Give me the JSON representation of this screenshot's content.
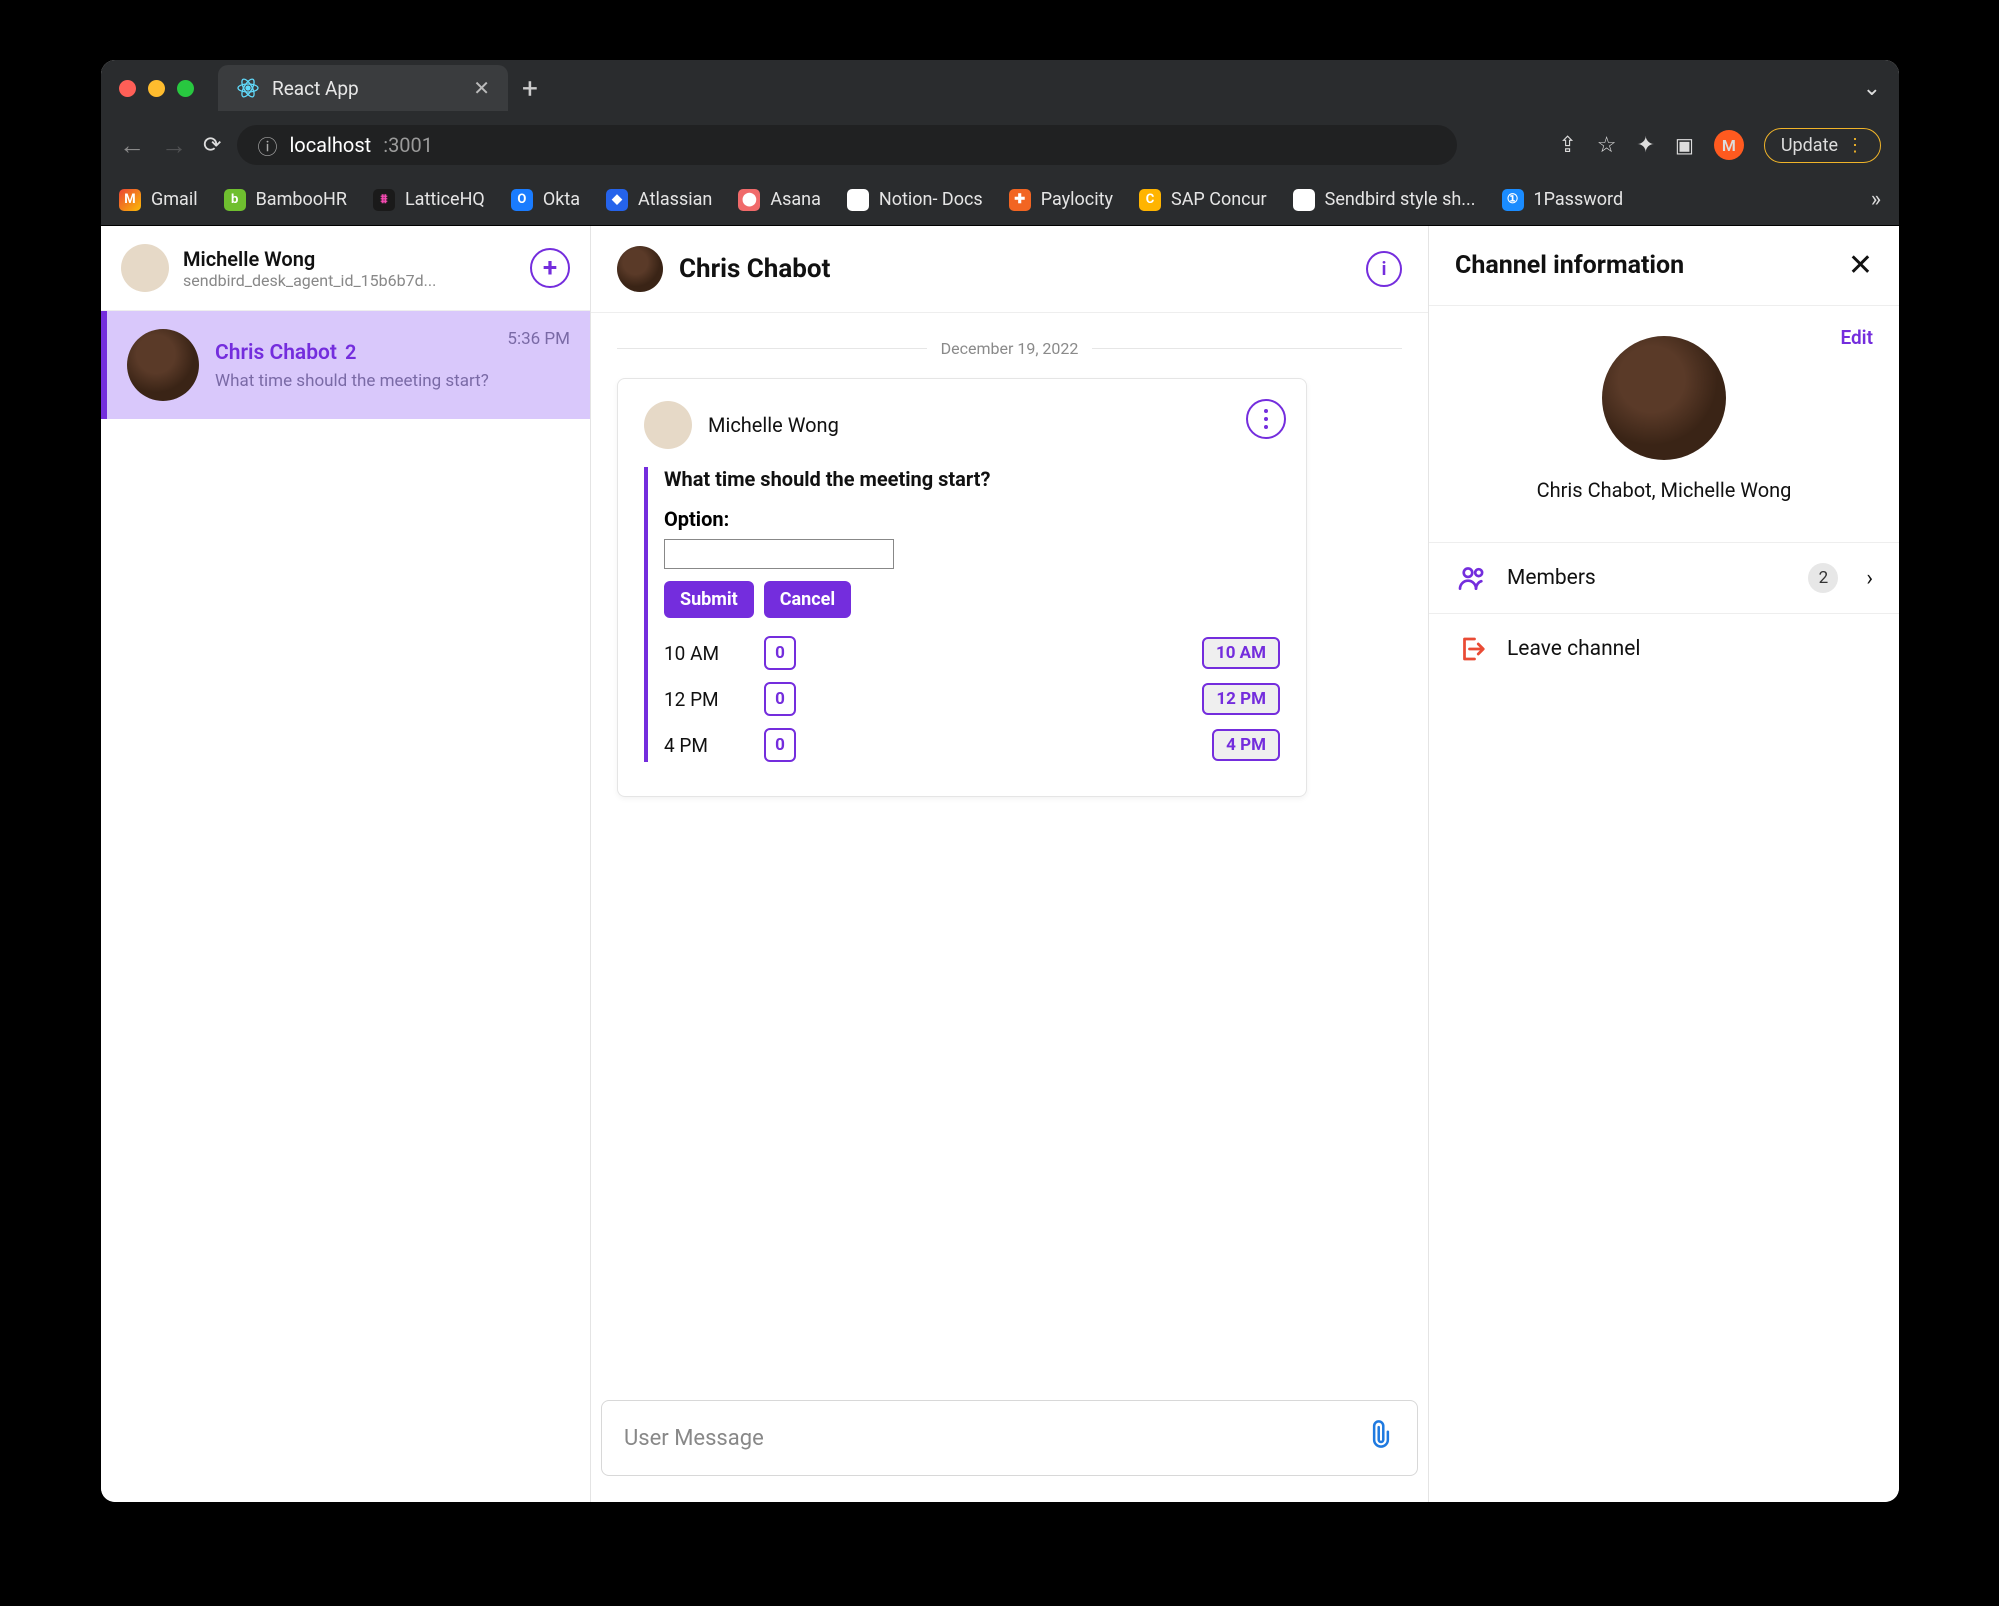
{
  "browser": {
    "tab_title": "React App",
    "url_host": "localhost",
    "url_port": ":3001",
    "update_label": "Update",
    "avatar_letter": "M",
    "bookmarks": [
      "Gmail",
      "BambooHR",
      "LatticeHQ",
      "Okta",
      "Atlassian",
      "Asana",
      "Notion- Docs",
      "Paylocity",
      "SAP Concur",
      "Sendbird style sh...",
      "1Password"
    ]
  },
  "sidebar": {
    "self_name": "Michelle Wong",
    "self_subtitle": "sendbird_desk_agent_id_15b6b7d...",
    "channels": [
      {
        "name": "Chris Chabot",
        "unread": "2",
        "preview": "What time should the meeting start?",
        "time": "5:36 PM"
      }
    ]
  },
  "conversation": {
    "header_name": "Chris Chabot",
    "date_label": "December 19, 2022",
    "message_sender": "Michelle Wong",
    "poll": {
      "question": "What time should the meeting start?",
      "option_label": "Option:",
      "submit": "Submit",
      "cancel": "Cancel",
      "options": [
        {
          "label": "10 AM",
          "count": "0",
          "vote": "10 AM"
        },
        {
          "label": "12 PM",
          "count": "0",
          "vote": "12 PM"
        },
        {
          "label": "4 PM",
          "count": "0",
          "vote": "4 PM"
        }
      ]
    },
    "composer_placeholder": "User Message"
  },
  "info_panel": {
    "title": "Channel information",
    "edit": "Edit",
    "names": "Chris Chabot, Michelle Wong",
    "members_label": "Members",
    "members_count": "2",
    "leave_label": "Leave channel"
  }
}
